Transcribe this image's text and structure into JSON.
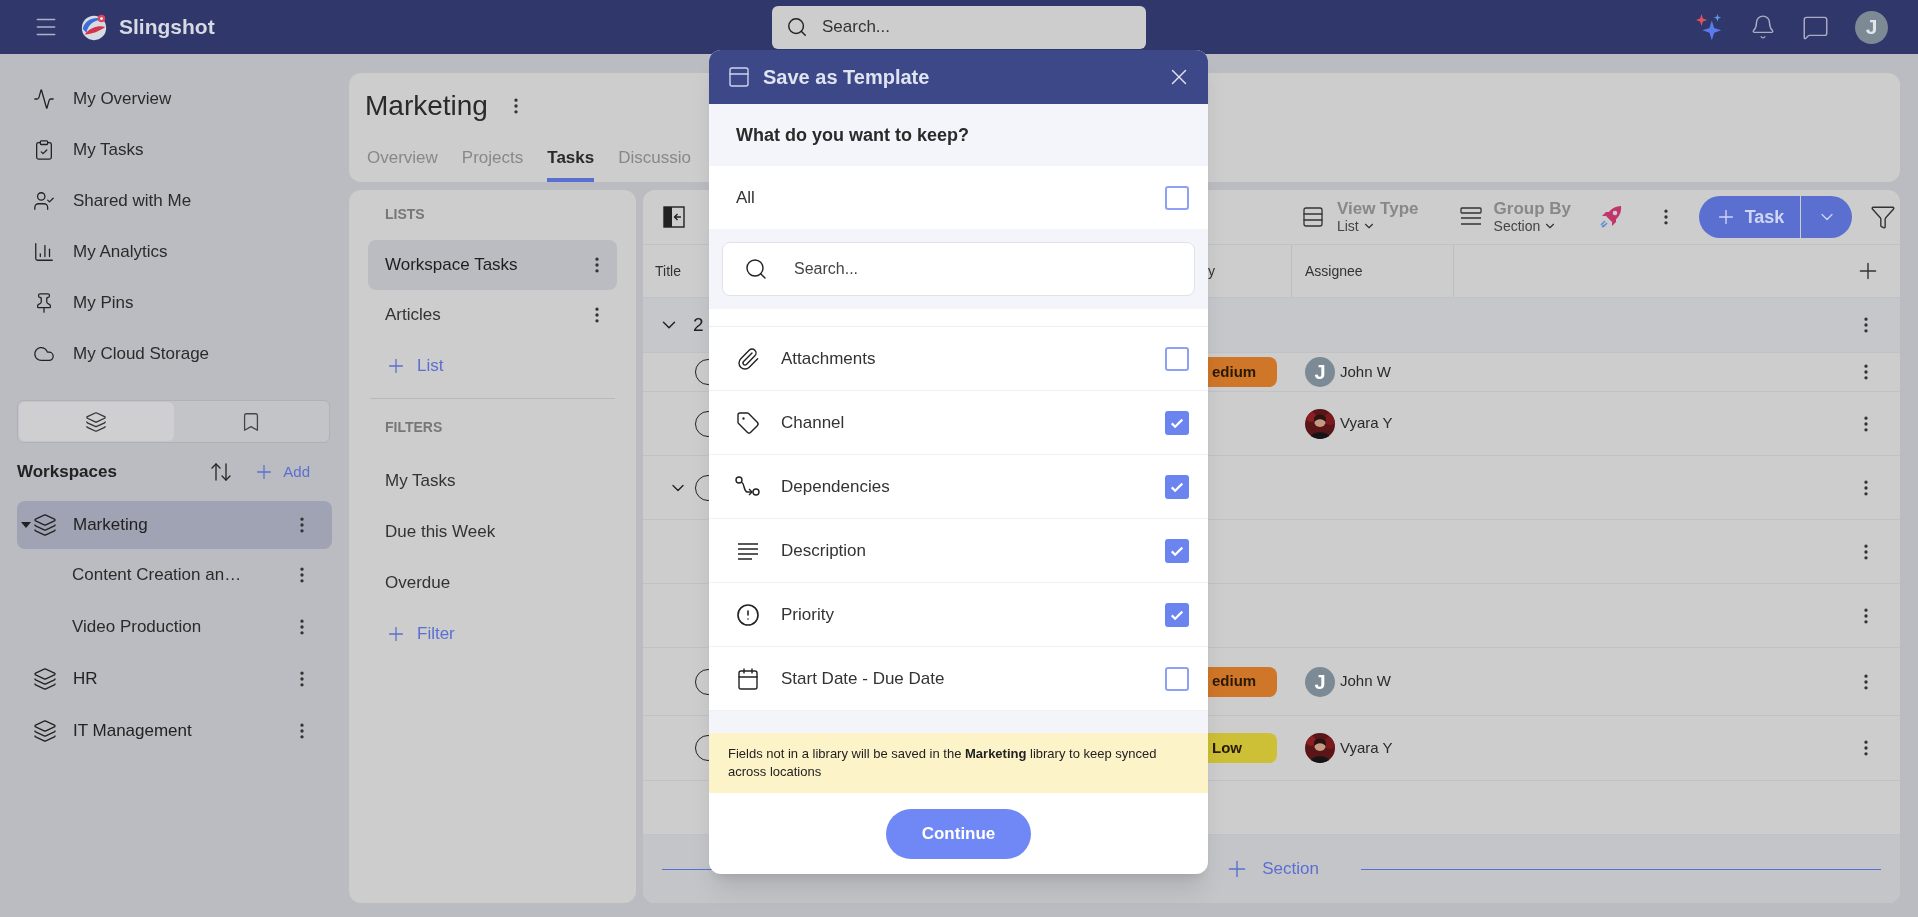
{
  "top_bar": {
    "app_name": "Slingshot",
    "search": {
      "placeholder": "Search..."
    },
    "avatar_initial": "J"
  },
  "sidebar": {
    "nav": [
      {
        "label": "My Overview"
      },
      {
        "label": "My Tasks"
      },
      {
        "label": "Shared with Me"
      },
      {
        "label": "My Analytics"
      },
      {
        "label": "My Pins"
      },
      {
        "label": "My Cloud Storage"
      }
    ],
    "view_toggle": [
      {
        "selected": true
      },
      {
        "selected": false
      }
    ],
    "workspaces": {
      "title": "Workspaces",
      "add_label": "Add",
      "items": [
        {
          "label": "Marketing",
          "selected": true,
          "expanded": true,
          "children": [
            {
              "label": "Content Creation an…"
            },
            {
              "label": "Video Production"
            }
          ]
        },
        {
          "label": "HR",
          "selected": false,
          "expanded": false
        },
        {
          "label": "IT Management",
          "selected": false,
          "expanded": false
        }
      ]
    }
  },
  "project": {
    "title": "Marketing",
    "tabs": [
      {
        "label": "Overview",
        "selected": false
      },
      {
        "label": "Projects",
        "selected": false
      },
      {
        "label": "Tasks",
        "selected": true
      },
      {
        "label": "Discussio",
        "selected": false
      }
    ]
  },
  "lists_panel": {
    "lists_heading": "LISTS",
    "lists": [
      {
        "label": "Workspace Tasks",
        "selected": true
      },
      {
        "label": "Articles",
        "selected": false
      }
    ],
    "add_list": "List",
    "filters_heading": "FILTERS",
    "filters": [
      {
        "label": "My Tasks"
      },
      {
        "label": "Due this Week"
      },
      {
        "label": "Overdue"
      }
    ],
    "add_filter": "Filter"
  },
  "task_view": {
    "view_type": {
      "label": "View Type",
      "value": "List"
    },
    "group_by": {
      "label": "Group By",
      "value": "Section"
    },
    "add_task": "Task",
    "columns": [
      "Title",
      "y",
      "Assignee"
    ],
    "rows": [
      {
        "kind": "group",
        "label": "2",
        "expanded": true
      },
      {
        "kind": "task",
        "expanded": false,
        "priority": {
          "label": "edium",
          "color": "#cf7628"
        },
        "assignee": {
          "name": "John W",
          "avatar": {
            "kind": "letter",
            "text": "J"
          }
        }
      },
      {
        "kind": "task",
        "expanded": false,
        "assignee": {
          "name": "Vyara Y"
        }
      },
      {
        "kind": "task",
        "expanded": true
      },
      {
        "kind": "subtask"
      },
      {
        "kind": "subtask"
      },
      {
        "kind": "task",
        "expanded": false,
        "priority": {
          "label": "edium",
          "color": "#cf7628"
        },
        "assignee": {
          "name": "John W",
          "avatar": {
            "kind": "letter",
            "text": "J"
          }
        }
      },
      {
        "kind": "task",
        "expanded": false,
        "priority": {
          "label": "Low",
          "color": "#cdbf36"
        },
        "assignee": {
          "name": "Vyara Y"
        }
      },
      {
        "kind": "add"
      }
    ],
    "add_section": "Section"
  },
  "modal": {
    "title": "Save as Template",
    "question": "What do you want to keep?",
    "all": {
      "label": "All",
      "checked": false
    },
    "search": {
      "placeholder": "Search..."
    },
    "fields": [
      {
        "label": "Attachments",
        "checked": false
      },
      {
        "label": "Channel",
        "checked": true
      },
      {
        "label": "Dependencies",
        "checked": true
      },
      {
        "label": "Description",
        "checked": true
      },
      {
        "label": "Priority",
        "checked": true
      },
      {
        "label": "Start Date - Due Date",
        "checked": false
      }
    ],
    "note": "Fields not in a library will be saved in the **Marketing** library to keep synced across locations",
    "continue": "Continue"
  }
}
